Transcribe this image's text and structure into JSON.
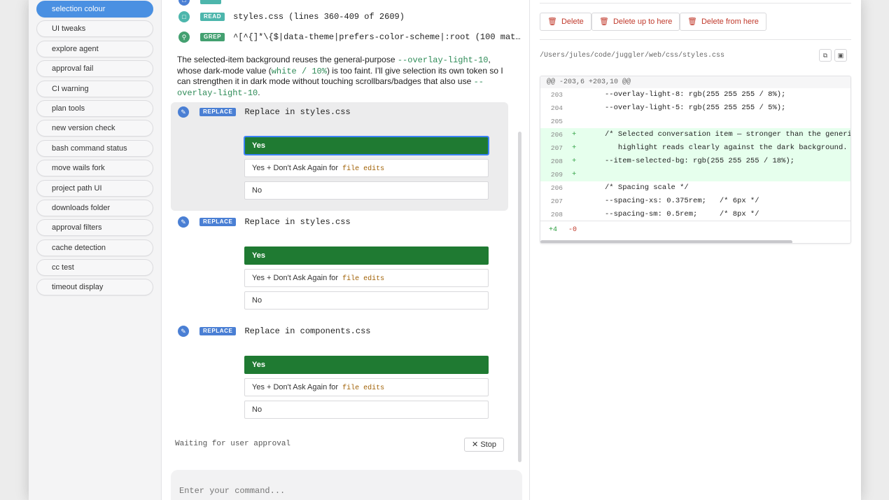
{
  "sidebar": {
    "items": [
      {
        "label": "selection colour",
        "active": true
      },
      {
        "label": "UI tweaks"
      },
      {
        "label": "explore agent"
      },
      {
        "label": "approval fail"
      },
      {
        "label": "CI warning"
      },
      {
        "label": "plan tools"
      },
      {
        "label": "new version check"
      },
      {
        "label": "bash command status"
      },
      {
        "label": "move wails fork"
      },
      {
        "label": "project path UI"
      },
      {
        "label": "downloads folder"
      },
      {
        "label": "approval filters"
      },
      {
        "label": "cache detection"
      },
      {
        "label": "cc test"
      },
      {
        "label": "timeout display"
      }
    ]
  },
  "chat": {
    "tools": [
      {
        "badge": "READ",
        "color": "#4db6ac",
        "icon": "file-icon",
        "text": "styles.css (lines 360-409 of 2609)"
      },
      {
        "badge": "GREP",
        "color": "#43a070",
        "icon": "search-icon",
        "text": "^[^{]*\\{$|data-theme|prefers-color-scheme|:root (100 mat…"
      }
    ],
    "paragraph": {
      "t1": "The selected-item background reuses the general-purpose ",
      "c1": "--overlay-light-10",
      "t2": ", whose dark-mode value (",
      "c2": "white / 10%",
      "t3": ") is too faint. I'll give selection its own token so I can strengthen it in dark mode without touching scrollbars/badges that also use ",
      "c3": "--overlay-light-10",
      "t4": "."
    },
    "approvals": [
      {
        "badge": "REPLACE",
        "title": "Replace in styles.css",
        "yes": "Yes",
        "always": "Yes + Don't Ask Again for",
        "always_hl": "file edits",
        "no": "No"
      },
      {
        "badge": "REPLACE",
        "title": "Replace in styles.css",
        "yes": "Yes",
        "always": "Yes + Don't Ask Again for",
        "always_hl": "file edits",
        "no": "No"
      },
      {
        "badge": "REPLACE",
        "title": "Replace in components.css",
        "yes": "Yes",
        "always": "Yes + Don't Ask Again for",
        "always_hl": "file edits",
        "no": "No"
      }
    ],
    "replace_color": "#4a7fd4",
    "status": "Waiting for user approval",
    "stop_label": "Stop",
    "input_placeholder": "Enter your command..."
  },
  "detail": {
    "delete_label": "Delete",
    "delete_up_label": "Delete up to here",
    "delete_from_label": "Delete from here",
    "file_path": "/Users/jules/code/juggler/web/css/styles.css",
    "diff": {
      "header": "@@ -203,6 +203,10 @@",
      "rows": [
        {
          "ln": "203",
          "sign": "",
          "code": "--overlay-light-8: rgb(255 255 255 / 8%);",
          "added": false
        },
        {
          "ln": "204",
          "sign": "",
          "code": "--overlay-light-5: rgb(255 255 255 / 5%);",
          "added": false
        },
        {
          "ln": "205",
          "sign": "",
          "code": "",
          "added": false
        },
        {
          "ln": "206",
          "sign": "+",
          "code": "/* Selected conversation item — stronger than the generic",
          "added": true
        },
        {
          "ln": "207",
          "sign": "+",
          "code": "   highlight reads clearly against the dark background. */",
          "added": true
        },
        {
          "ln": "208",
          "sign": "+",
          "code": "--item-selected-bg: rgb(255 255 255 / 18%);",
          "added": true
        },
        {
          "ln": "209",
          "sign": "+",
          "code": "",
          "added": true
        },
        {
          "ln": "206",
          "sign": "",
          "code": "/* Spacing scale */",
          "added": false
        },
        {
          "ln": "207",
          "sign": "",
          "code": "--spacing-xs: 0.375rem;   /* 6px */",
          "added": false
        },
        {
          "ln": "208",
          "sign": "",
          "code": "--spacing-sm: 0.5rem;     /* 8px */",
          "added": false
        }
      ],
      "added_count": "+4",
      "removed_count": "-0"
    }
  }
}
